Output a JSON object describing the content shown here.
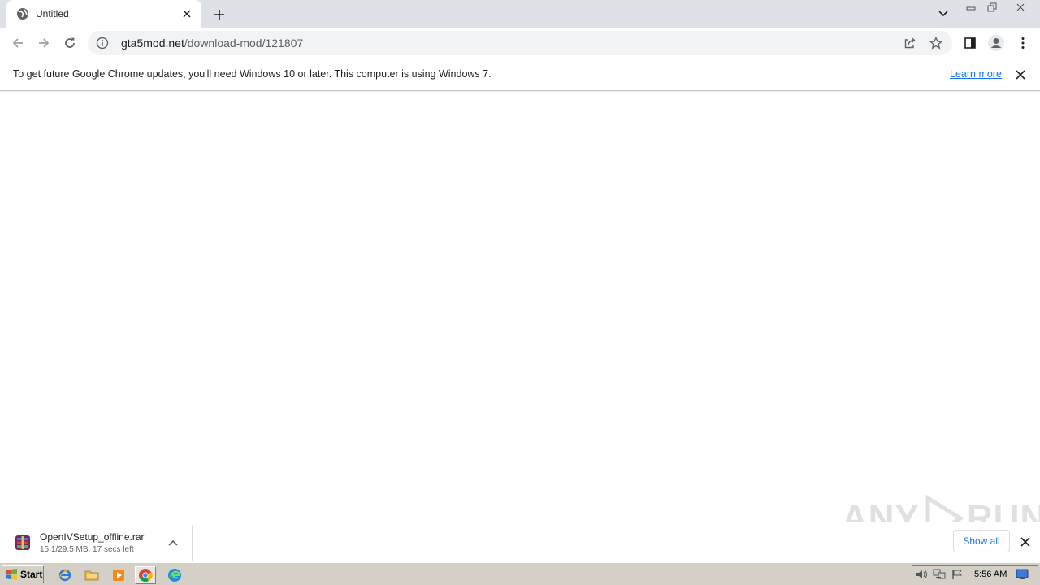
{
  "browser": {
    "tab": {
      "title": "Untitled",
      "favicon": "globe-icon"
    },
    "address": {
      "domain": "gta5mod.net",
      "path": "/download-mod/121807"
    }
  },
  "infobar": {
    "message": "To get future Google Chrome updates, you'll need Windows 10 or later. This computer is using Windows 7.",
    "learn_more": "Learn more"
  },
  "download": {
    "filename": "OpenIVSetup_offline.rar",
    "status": "15.1/29.5 MB, 17 secs left",
    "show_all": "Show all"
  },
  "watermark": {
    "left": "ANY",
    "right": "RUN"
  },
  "taskbar": {
    "start_label": "Start",
    "clock": "5:56 AM",
    "apps": [
      "ie-icon",
      "folder-icon",
      "media-player-icon",
      "chrome-icon",
      "edge-icon"
    ]
  },
  "colors": {
    "accent": "#1a73e8",
    "tabstrip": "#dee1e6",
    "taskbar": "#d4d0c8"
  }
}
